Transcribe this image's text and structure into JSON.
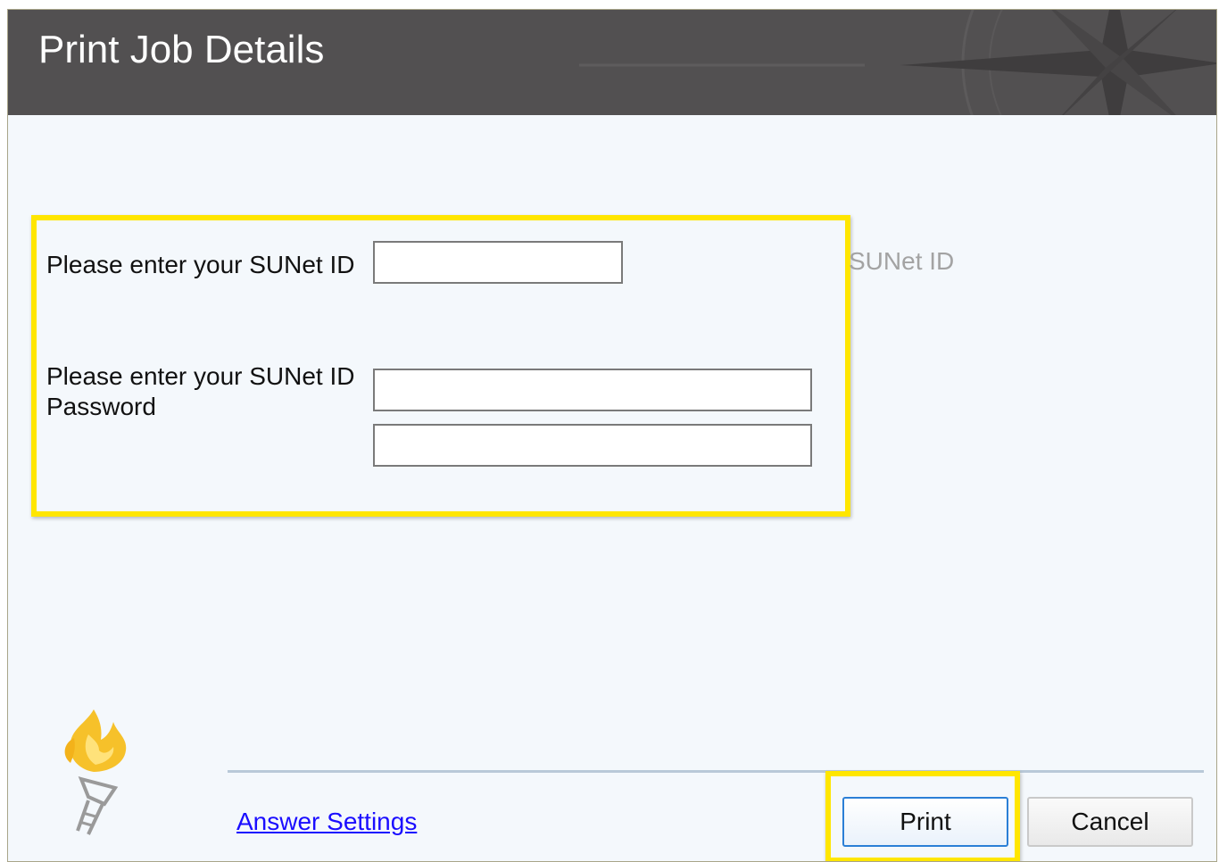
{
  "window": {
    "title": "Print Job Details"
  },
  "form": {
    "sunet_id_label": "Please enter your SUNet ID",
    "sunet_id_value": "",
    "password_label": "Please enter your SUNet ID Password",
    "password_value": "",
    "password_confirm_value": "",
    "hint_text": "SUNet ID"
  },
  "footer": {
    "answer_settings_link": "Answer Settings",
    "print_label": "Print",
    "cancel_label": "Cancel"
  },
  "colors": {
    "titlebar": "#525051",
    "highlight": "#ffe600",
    "link": "#1a0dff",
    "dialog_background": "#f4f8fc"
  },
  "icons": {
    "logo": "torch-icon",
    "titlebar_decoration": "compass-star-icon"
  }
}
